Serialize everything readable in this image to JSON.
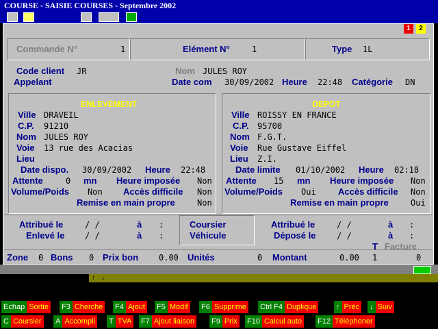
{
  "window": {
    "title": "COURSE - SAISIE COURSES - Septembre 2002"
  },
  "panel_buttons": {
    "b1": "1",
    "b2": "2"
  },
  "header": {
    "commande_label": "Commande N°",
    "commande_value": "1",
    "element_label": "Elément N°",
    "element_value": "1",
    "type_label": "Type",
    "type_value": "1L"
  },
  "client": {
    "code_label": "Code client",
    "code_value": "JR",
    "nom_label": "Nom",
    "nom_value": "JULES ROY",
    "appelant_label": "Appelant",
    "datecom_label": "Date com",
    "datecom_value": "30/09/2002",
    "heure_label": "Heure",
    "heure_value": "22:48",
    "categorie_label": "Catégorie",
    "categorie_value": "DN"
  },
  "enlevement": {
    "title": "ENLEVEMENT",
    "ville_label": "Ville",
    "ville": "DRAVEIL",
    "cp_label": "C.P.",
    "cp": "91210",
    "nom_label": "Nom",
    "nom": "JULES ROY",
    "voie_label": "Voie",
    "voie": "13 rue des Acacias",
    "lieu_label": "Lieu",
    "lieu": "",
    "date_label": "Date dispo.",
    "date": "30/09/2002",
    "heure_label": "Heure",
    "heure": "22:48",
    "attente_label": "Attente",
    "attente": "0",
    "attente_unit": "mn",
    "heure_imposee_label": "Heure imposée",
    "heure_imposee": "Non",
    "volume_label": "Volume/Poids",
    "volume": "Non",
    "acces_label": "Accès difficile",
    "acces": "Non",
    "remise_label": "Remise en main propre",
    "remise": "Non"
  },
  "depot": {
    "title": "DEPOT",
    "ville_label": "Ville",
    "ville": "ROISSY EN FRANCE",
    "cp_label": "C.P.",
    "cp": "95700",
    "nom_label": "Nom",
    "nom": "F.G.T.",
    "voie_label": "Voie",
    "voie": "Rue Gustave Eiffel",
    "lieu_label": "Lieu",
    "lieu": "Z.I.",
    "date_label": "Date limite",
    "date": "01/10/2002",
    "heure_label": "Heure",
    "heure": "02:18",
    "attente_label": "Attente",
    "attente": "15",
    "attente_unit": "mn",
    "heure_imposee_label": "Heure imposée",
    "heure_imposee": "Non",
    "volume_label": "Volume/Poids",
    "volume": "Oui",
    "acces_label": "Accès difficile",
    "acces": "Non",
    "remise_label": "Remise en main propre",
    "remise": "Oui"
  },
  "assign": {
    "attribue_label": "Attribué le",
    "enleve_label": "Enlevé le",
    "a_label": "à",
    "date_blank": "/  /",
    "time_blank": ":",
    "coursier_label": "Coursier",
    "vehicule_label": "Véhicule",
    "attribue2_label": "Attribué le",
    "depose_label": "Déposé le"
  },
  "totals": {
    "zone_label": "Zone",
    "zone": "0",
    "bons_label": "Bons",
    "bons": "0",
    "prixbon_label": "Prix bon",
    "prixbon": "0.00",
    "unites_label": "Unités",
    "unites": "0",
    "montant_label": "Montant",
    "montant": "0.00",
    "t_label": "T",
    "t_value": "1",
    "facture_label": "Facture",
    "facture": "0"
  },
  "fkeys_row1": [
    {
      "key": "Echap",
      "action": "Sortie"
    },
    {
      "key": "F3",
      "action": "Cherche"
    },
    {
      "key": "F4",
      "action": "Ajout"
    },
    {
      "key": "F5",
      "action": "Modif"
    },
    {
      "key": "F6",
      "action": "Supprime"
    },
    {
      "key": "Ctrl F4",
      "action": "Duplique"
    },
    {
      "key": "↑",
      "action": "Préc"
    },
    {
      "key": "↓",
      "action": "Suiv"
    }
  ],
  "fkeys_row2": [
    {
      "key": "C",
      "action": "Coursier"
    },
    {
      "key": "A",
      "action": "Accompli"
    },
    {
      "key": "T",
      "action": "TVA"
    },
    {
      "key": "F7",
      "action": "Ajout liaison"
    },
    {
      "key": "F9",
      "action": "Prix"
    },
    {
      "key": "F10",
      "action": "Calcul auto"
    },
    {
      "key": "F12",
      "action": "Téléphoner"
    }
  ],
  "colors": {
    "title_bg": "#0000aa",
    "panel_bg": "#c0c0c0",
    "label": "#00008b",
    "section_title": "#ffff00",
    "fkey_green": "#008000",
    "fkey_red": "#ee0000"
  }
}
